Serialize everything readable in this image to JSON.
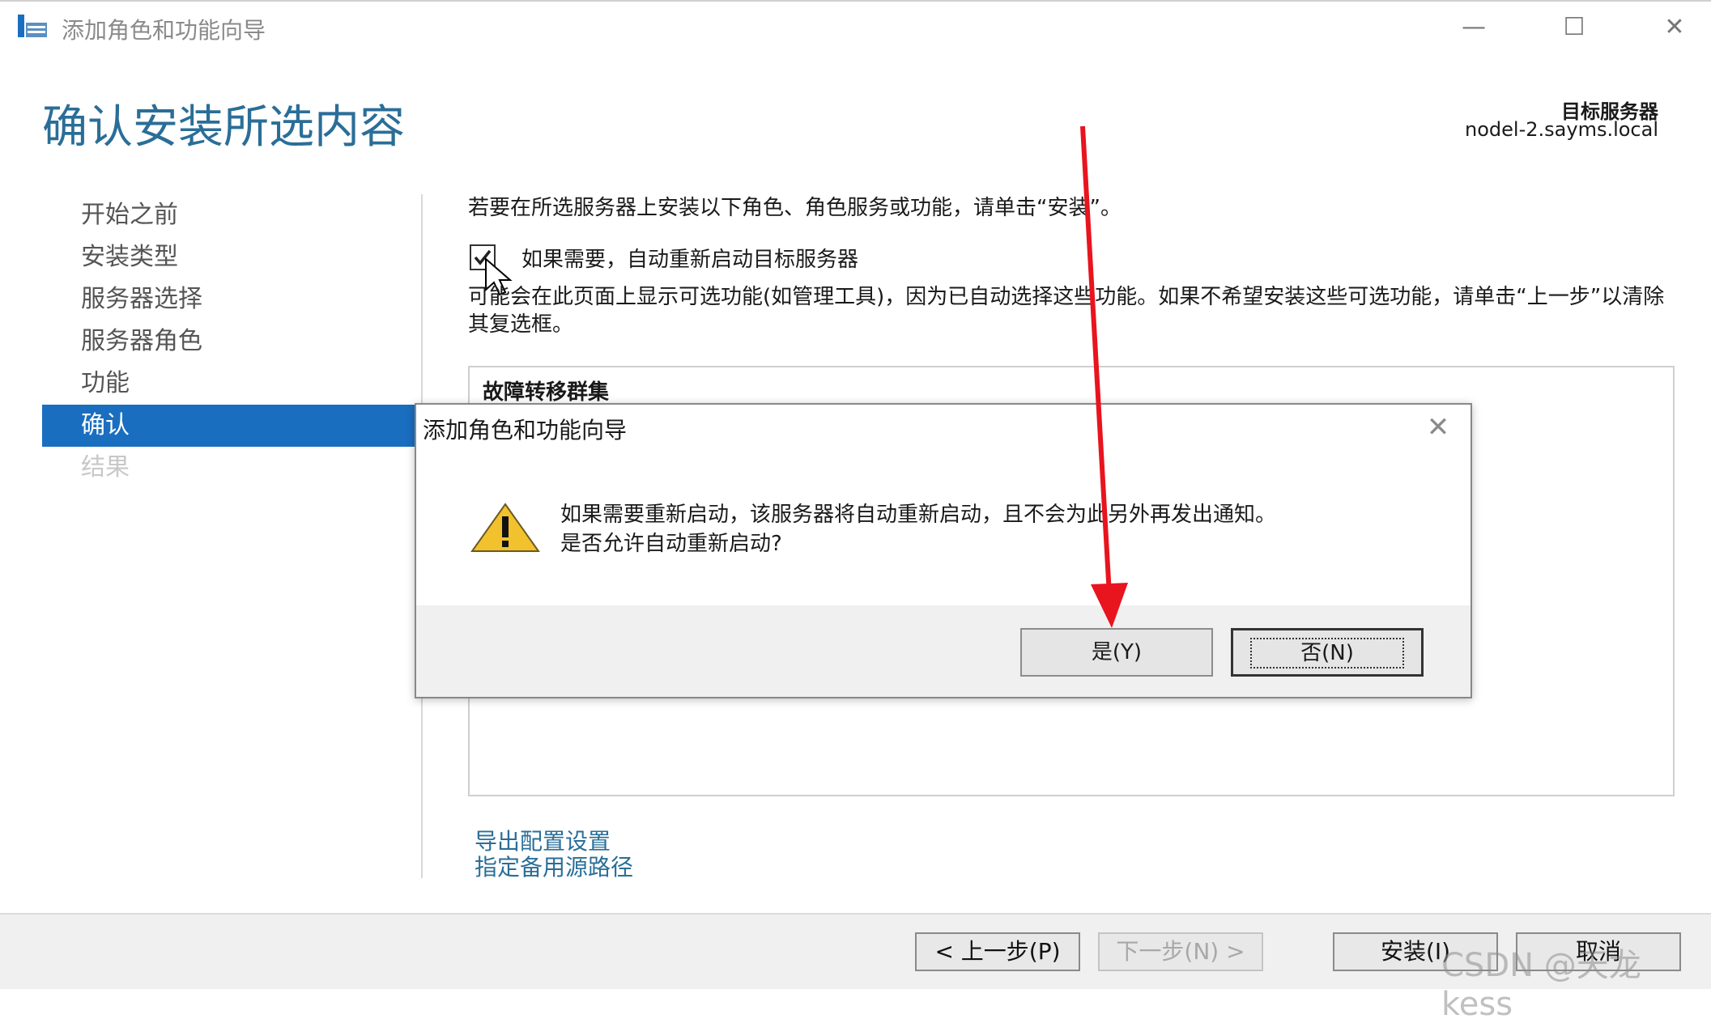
{
  "window": {
    "title": "添加角色和功能向导",
    "minimize": "—",
    "maximize": "☐",
    "close": "✕"
  },
  "page": {
    "heading": "确认安装所选内容",
    "destination_label": "目标服务器",
    "destination_value": "nodel-2.sayms.local"
  },
  "sidebar": {
    "items": [
      {
        "label": "开始之前"
      },
      {
        "label": "安装类型"
      },
      {
        "label": "服务器选择"
      },
      {
        "label": "服务器角色"
      },
      {
        "label": "功能"
      },
      {
        "label": "确认"
      },
      {
        "label": "结果"
      }
    ]
  },
  "content": {
    "intro": "若要在所选服务器上安装以下角色、角色服务或功能，请单击“安装”。",
    "restart_checkbox_label": "如果需要，自动重新启动目标服务器",
    "restart_checked": true,
    "note": "可能会在此页面上显示可选功能(如管理工具)，因为已自动选择这些功能。如果不希望安装这些可选功能，请单击“上一步”以清除其复选框。",
    "features": [
      "故障转移群集"
    ],
    "link_export": "导出配置设置",
    "link_source": "指定备用源路径"
  },
  "footer": {
    "prev": "< 上一步(P)",
    "next": "下一步(N) >",
    "install": "安装(I)",
    "cancel": "取消"
  },
  "dialog": {
    "title": "添加角色和功能向导",
    "close": "✕",
    "message_line1": "如果需要重新启动，该服务器将自动重新启动，且不会为此另外再发出通知。",
    "message_line2": "是否允许自动重新启动?",
    "yes": "是(Y)",
    "no": "否(N)"
  },
  "watermark": "CSDN @天龙kess",
  "colors": {
    "accent": "#1a6ec0",
    "heading": "#2a6e98",
    "annotation_arrow": "#e8141e"
  }
}
